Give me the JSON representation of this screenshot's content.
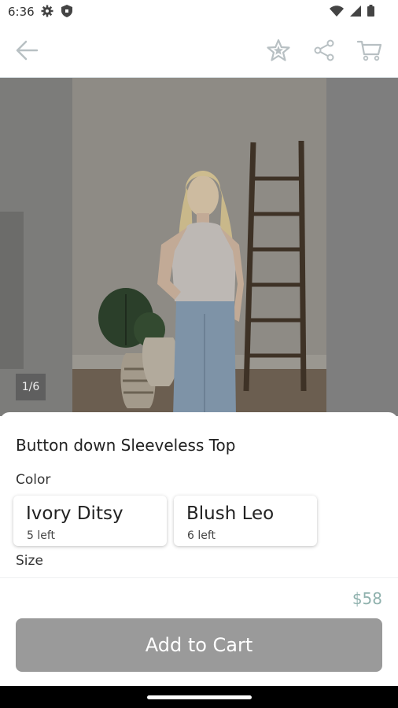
{
  "status_bar": {
    "time": "6:36"
  },
  "header": {
    "back_icon": "arrow-left-icon",
    "favorite_icon": "star-icon",
    "share_icon": "share-icon",
    "cart_icon": "cart-icon"
  },
  "gallery": {
    "counter": "1/6"
  },
  "product": {
    "title": "Button down Sleeveless Top",
    "color_label": "Color",
    "colors": [
      {
        "name": "Ivory Ditsy",
        "stock": "5 left"
      },
      {
        "name": "Blush Leo",
        "stock": "6 left"
      }
    ],
    "size_label": "Size",
    "price": "$58",
    "add_to_cart": "Add to Cart"
  },
  "colors": {
    "price": "#8fb1ad",
    "button": "#9a9a9a"
  }
}
